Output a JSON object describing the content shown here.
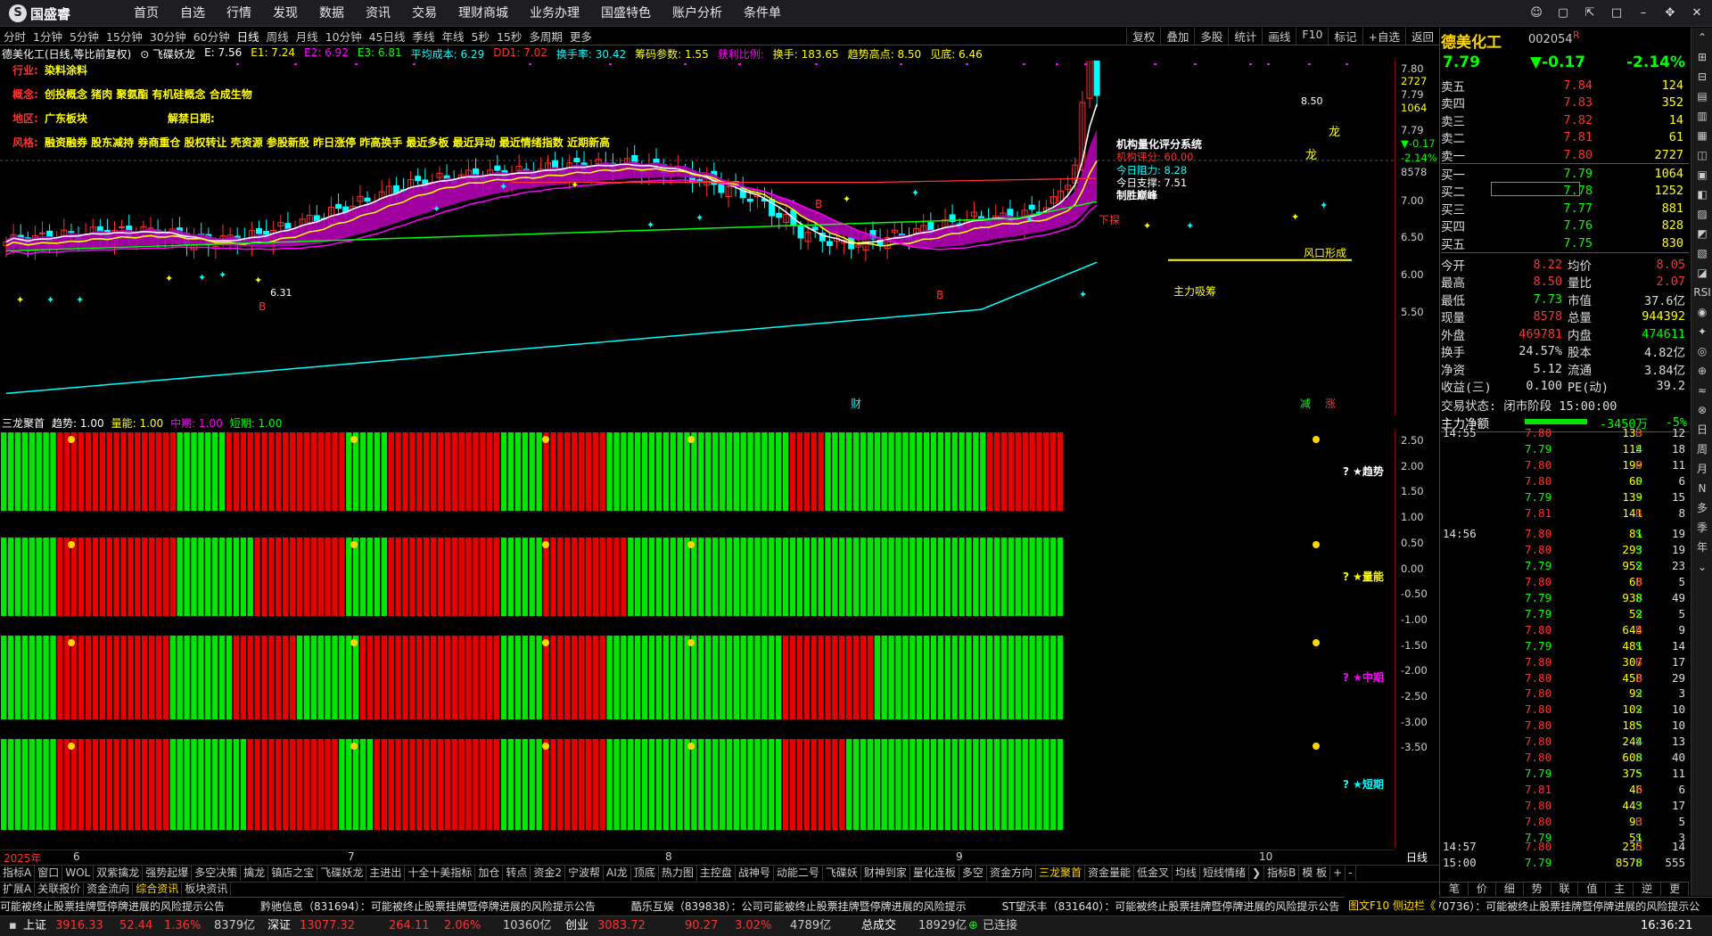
{
  "app": {
    "logo": "国盛睿",
    "nav": [
      "首页",
      "自选",
      "行情",
      "发现",
      "数据",
      "资讯",
      "交易",
      "理财商城",
      "业务办理",
      "国盛特色",
      "账户分析",
      "条件单"
    ],
    "window_controls": [
      "☺",
      "▢",
      "⇱",
      "□",
      "–",
      "✥",
      "✕"
    ]
  },
  "timeframes": [
    "分时",
    "1分钟",
    "5分钟",
    "15分钟",
    "30分钟",
    "60分钟",
    "日线",
    "周线",
    "月线",
    "10分钟",
    "45日线",
    "季线",
    "年线",
    "5秒",
    "15秒",
    "多周期",
    "更多"
  ],
  "active_tf": "日线",
  "toolbar_right": [
    "复权",
    "叠加",
    "多股",
    "统计",
    "画线",
    "F10",
    "标记",
    "+自选",
    "返回"
  ],
  "indicator_line": [
    {
      "t": "德美化工(日线,等比前复权)",
      "c": "#ffffff"
    },
    {
      "t": "⊙ 飞碟妖龙",
      "c": "#ffffff"
    },
    {
      "t": "E: 7.56",
      "c": "#ffffff"
    },
    {
      "t": "E1: 7.24",
      "c": "#ffff00"
    },
    {
      "t": "E2: 6.92",
      "c": "#ff00ff"
    },
    {
      "t": "E3: 6.81",
      "c": "#00ff00"
    },
    {
      "t": "平均成本: 6.29",
      "c": "#00ffff"
    },
    {
      "t": "DD1: 7.02",
      "c": "#ff3030"
    },
    {
      "t": "换手率: 30.42",
      "c": "#00ffff"
    },
    {
      "t": "筹码参数: 1.55",
      "c": "#ffff00"
    },
    {
      "t": "获利比例:",
      "c": "#ff00ff"
    },
    {
      "t": "换手: 183.65",
      "c": "#ffff00"
    },
    {
      "t": "趋势高点: 8.50",
      "c": "#ffff00"
    },
    {
      "t": "见底: 6.46",
      "c": "#ffff00"
    }
  ],
  "info": {
    "hangye_k": "行业:",
    "hangye_v": "染料涂料",
    "gainian_k": "概念:",
    "gainian_v": "创投概念 猪肉 聚氨酯 有机硅概念 合成生物",
    "diqu_k": "地区:",
    "diqu_v": "广东板块",
    "jiejin": "解禁日期:",
    "fengge_k": "风格:",
    "fengge_v": "融资融券 股东减持 券商重仓 股权转让 壳资源 参股新股 昨日涨停 昨高换手 最近多板 最近异动 最近情绪指数 近期新高"
  },
  "score": {
    "title": "机构量化评分系统",
    "s1": "机构评分:  60.00",
    "s2": "今日阻力:  8.28",
    "s3": "今日支撑:  7.51",
    "s4": "制胜巅峰"
  },
  "chart_labels": {
    "hi": "8.50",
    "lo": "6.31",
    "xiatan": "下探",
    "long1": "龙",
    "long2": "龙",
    "zhuli": "主力吸筹",
    "fengkou": "风口形成",
    "cai": "财",
    "jian": "减",
    "zhang": "涨",
    "b": "B"
  },
  "main_axis": [
    "7.80",
    "2727",
    "7.79",
    "1064",
    "7.79",
    "▼-0.17",
    "-2.14%",
    "8578",
    "7.00",
    "6.50",
    "6.00",
    "5.50"
  ],
  "sub_indicator": {
    "name": "三龙聚首",
    "qushi": "趋势: 1.00",
    "liangneng": "量能: 1.00",
    "zhongqi": "中期: 1.00",
    "duanqi": "短期: 1.00"
  },
  "sub_axis": [
    "2.50",
    "2.00",
    "1.50",
    "1.00",
    "0.50",
    "0.00",
    "-0.50",
    "-1.00",
    "-1.50",
    "-2.00",
    "-2.50",
    "-3.00",
    "-3.50"
  ],
  "row_labels": [
    "? ★趋势",
    "? ★量能",
    "? ★中期",
    "? ★短期"
  ],
  "dates": {
    "year": "2025年",
    "m6": "6",
    "m7": "7",
    "m8": "8",
    "m9": "9",
    "m10": "10"
  },
  "day_label": "日线",
  "tabs1": [
    "指标A",
    "窗口",
    "WOL",
    "双紫擒龙",
    "强势起爆",
    "多空决策",
    "擒龙",
    "镇店之宝",
    "飞碟妖龙",
    "主进出",
    "十全十美指标",
    "加仓",
    "转点",
    "资金2",
    "宁波帮",
    "AI龙",
    "顶底",
    "热力图",
    "主控盘",
    "战神号",
    "动能二号",
    "飞碟妖",
    "财神到家",
    "量化连板",
    "多空",
    "资金方向",
    "三龙聚首",
    "资金量能",
    "低金叉",
    "均线",
    "短线情绪",
    "❯",
    "指标B",
    "模 板",
    "+",
    "-"
  ],
  "tabs2": [
    "扩展A",
    "关联报价",
    "资金流向",
    "综合资讯",
    "板块资讯"
  ],
  "ticker": [
    "可能被终止股票挂牌暨停牌进展的风险提示公告",
    "黔驰信息（831694）：可能被终止股票挂牌暨停牌进展的风险提示公告",
    "酷乐互娱（839838）：公司可能被终止股票挂牌暨停牌进展的风险提示",
    "ST望沃丰（831640）：可能被终止股票挂牌暨停牌进展的风险提示公告",
    "盛态粮食（870736）：可能被终止股票挂牌暨停牌进展的风险提示公"
  ],
  "ticker_right": "图文F10 侧边栏《",
  "status": {
    "sh_k": "上证",
    "sh_v": "3916.33",
    "sh_c": "52.44",
    "sh_p": "1.36%",
    "sh_a": "8379亿",
    "sz_k": "深证",
    "sz_v": "13077.32",
    "sz_c": "264.11",
    "sz_p": "2.06%",
    "sz_a": "10360亿",
    "cy_k": "创业",
    "cy_v": "3083.72",
    "cy_c": "90.27",
    "cy_p": "3.02%",
    "cy_a": "4789亿",
    "tot_k": "总成交",
    "tot_v": "18929亿",
    "conn": "已连接",
    "time": "16:36:21"
  },
  "quote": {
    "name": "德美化工",
    "code": "002054",
    "r": "R",
    "price": "7.79",
    "chg": "▼-0.17",
    "pct": "-2.14%",
    "asks": [
      [
        "卖五",
        "7.84",
        "124"
      ],
      [
        "卖四",
        "7.83",
        "352"
      ],
      [
        "卖三",
        "7.82",
        "14"
      ],
      [
        "卖二",
        "7.81",
        "61"
      ],
      [
        "卖一",
        "7.80",
        "2727"
      ]
    ],
    "bids": [
      [
        "买一",
        "7.79",
        "1064"
      ],
      [
        "买二",
        "7.78",
        "1252"
      ],
      [
        "买三",
        "7.77",
        "881"
      ],
      [
        "买四",
        "7.76",
        "828"
      ],
      [
        "买五",
        "7.75",
        "830"
      ]
    ],
    "stats": [
      [
        "今开",
        "8.22",
        "均价",
        "8.05"
      ],
      [
        "最高",
        "8.50",
        "量比",
        "2.07"
      ],
      [
        "最低",
        "7.73",
        "市值",
        "37.6亿"
      ],
      [
        "现量",
        "8578",
        "总量",
        "944392"
      ],
      [
        "外盘",
        "469781",
        "内盘",
        "474611"
      ],
      [
        "换手",
        "24.57%",
        "股本",
        "4.82亿"
      ],
      [
        "净资",
        "5.12",
        "流通",
        "3.84亿"
      ],
      [
        "收益(三)",
        "0.100",
        "PE(动)",
        "39.2"
      ]
    ],
    "state": "交易状态: 闭市阶段 15:00:00",
    "zljk": "主力净额",
    "zljv": "-3450万",
    "zljp": "-5%"
  },
  "ticks": [
    [
      "14:55",
      "7.80",
      "133",
      "B",
      "12"
    ],
    [
      "",
      "7.79",
      "114",
      "S",
      "18"
    ],
    [
      "",
      "7.80",
      "199",
      "B",
      "11"
    ],
    [
      "",
      "7.80",
      "60",
      "S",
      "6"
    ],
    [
      "",
      "7.79",
      "139",
      "S",
      "15"
    ],
    [
      "",
      "7.81",
      "141",
      "B",
      "8"
    ],
    [
      "14:56",
      "7.80",
      "81",
      "S",
      "19"
    ],
    [
      "",
      "7.80",
      "293",
      "S",
      "19"
    ],
    [
      "",
      "7.79",
      "952",
      "S",
      "23"
    ],
    [
      "",
      "7.80",
      "68",
      "B",
      "5"
    ],
    [
      "",
      "7.79",
      "938",
      "S",
      "49"
    ],
    [
      "",
      "7.79",
      "52",
      "S",
      "5"
    ],
    [
      "",
      "7.80",
      "644",
      "B",
      "9"
    ],
    [
      "",
      "7.79",
      "481",
      "S",
      "14"
    ],
    [
      "",
      "7.80",
      "307",
      "B",
      "17"
    ],
    [
      "",
      "7.80",
      "458",
      "B",
      "29"
    ],
    [
      "",
      "7.80",
      "92",
      "S",
      "3"
    ],
    [
      "",
      "7.80",
      "102",
      "S",
      "10"
    ],
    [
      "",
      "7.80",
      "185",
      "S",
      "10"
    ],
    [
      "",
      "7.80",
      "244",
      "S",
      "13"
    ],
    [
      "",
      "7.80",
      "608",
      "S",
      "40"
    ],
    [
      "",
      "7.79",
      "375",
      "S",
      "11"
    ],
    [
      "",
      "7.81",
      "46",
      "B",
      "6"
    ],
    [
      "",
      "7.80",
      "443",
      "S",
      "17"
    ],
    [
      "",
      "7.80",
      "93",
      "B",
      "5"
    ],
    [
      "",
      "7.79",
      "51",
      "S",
      "3"
    ],
    [
      "14:57",
      "7.80",
      "235",
      "B",
      "14"
    ],
    [
      "15:00",
      "7.79",
      "8578",
      "S",
      "555"
    ]
  ],
  "rp_bottom": [
    "笔",
    "价",
    "细",
    "势",
    "联",
    "值",
    "主",
    "逆",
    "更"
  ],
  "sidebar": [
    "⌃",
    "⊞",
    "⊟",
    "▤",
    "▥",
    "▦",
    "◫",
    "▣",
    "◧",
    "▨",
    "◩",
    "▧",
    "◪",
    "RSI",
    "◉",
    "✦",
    "◎",
    "⊕",
    "≈",
    "⊗",
    "日",
    "周",
    "月",
    "N",
    "多",
    "季",
    "年",
    "⌄"
  ],
  "colors": {
    "up": "#ff3030",
    "down": "#00ff00",
    "axis": "#8b0000"
  }
}
